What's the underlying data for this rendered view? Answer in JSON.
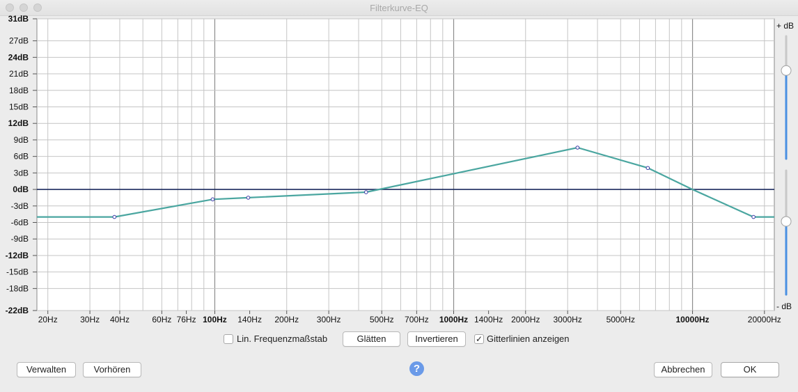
{
  "window": {
    "title": "Filterkurve-EQ"
  },
  "chart_data": {
    "type": "line",
    "y_tick_labels": [
      "31dB",
      "27dB",
      "24dB",
      "21dB",
      "18dB",
      "15dB",
      "12dB",
      "9dB",
      "6dB",
      "3dB",
      "0dB",
      "-3dB",
      "-6dB",
      "-9dB",
      "-12dB",
      "-15dB",
      "-18dB",
      "-22dB"
    ],
    "y_tick_values": [
      31,
      27,
      24,
      21,
      18,
      15,
      12,
      9,
      6,
      3,
      0,
      -3,
      -6,
      -9,
      -12,
      -15,
      -18,
      -22
    ],
    "bold_y_ticks": [
      "31dB",
      "24dB",
      "12dB",
      "0dB",
      "-12dB",
      "-22dB"
    ],
    "ylim": [
      -22,
      31
    ],
    "x_tick_labels": [
      "20Hz",
      "30Hz",
      "40Hz",
      "60Hz",
      "76Hz",
      "100Hz",
      "140Hz",
      "200Hz",
      "300Hz",
      "500Hz",
      "700Hz",
      "1000Hz",
      "1400Hz",
      "2000Hz",
      "3000Hz",
      "5000Hz",
      "10000Hz",
      "20000Hz"
    ],
    "x_tick_values": [
      20,
      30,
      40,
      60,
      76,
      100,
      140,
      200,
      300,
      500,
      700,
      1000,
      1400,
      2000,
      3000,
      5000,
      10000,
      20000
    ],
    "bold_x_ticks": [
      "100Hz",
      "1000Hz",
      "10000Hz"
    ],
    "x_scale": "log",
    "xlim": [
      18,
      22000
    ],
    "grid": true,
    "series": [
      {
        "x": [
          18,
          38,
          98,
          138,
          430,
          3300,
          6500,
          10000,
          18000,
          22000
        ],
        "y": [
          -5,
          -5,
          -1.8,
          -1.5,
          -0.5,
          7.6,
          3.9,
          0,
          -5,
          -5
        ],
        "control_points_x": [
          38,
          98,
          138,
          430,
          3300,
          6500,
          18000
        ],
        "control_points_y": [
          -5,
          -1.8,
          -1.5,
          -0.5,
          7.6,
          3.9,
          -5
        ],
        "color": "#4aa6a0"
      }
    ],
    "zero_line_color": "#1b2a5e",
    "slider_labels": {
      "top": "+ dB",
      "bottom": "- dB"
    },
    "slider_values": {
      "max_db_fraction": 0.72,
      "min_db_fraction": 0.59
    }
  },
  "controls": {
    "lin_freq_label": "Lin. Frequenzmaßstab",
    "lin_freq_checked": false,
    "smooth_label": "Glätten",
    "invert_label": "Invertieren",
    "gridlines_label": "Gitterlinien anzeigen",
    "gridlines_checked": true
  },
  "footer": {
    "manage_label": "Verwalten",
    "preview_label": "Vorhören",
    "help_label": "?",
    "cancel_label": "Abbrechen",
    "ok_label": "OK"
  },
  "colors": {
    "accent": "#4a90e2",
    "curve": "#4aa6a0",
    "help": "#6a9ae8"
  }
}
